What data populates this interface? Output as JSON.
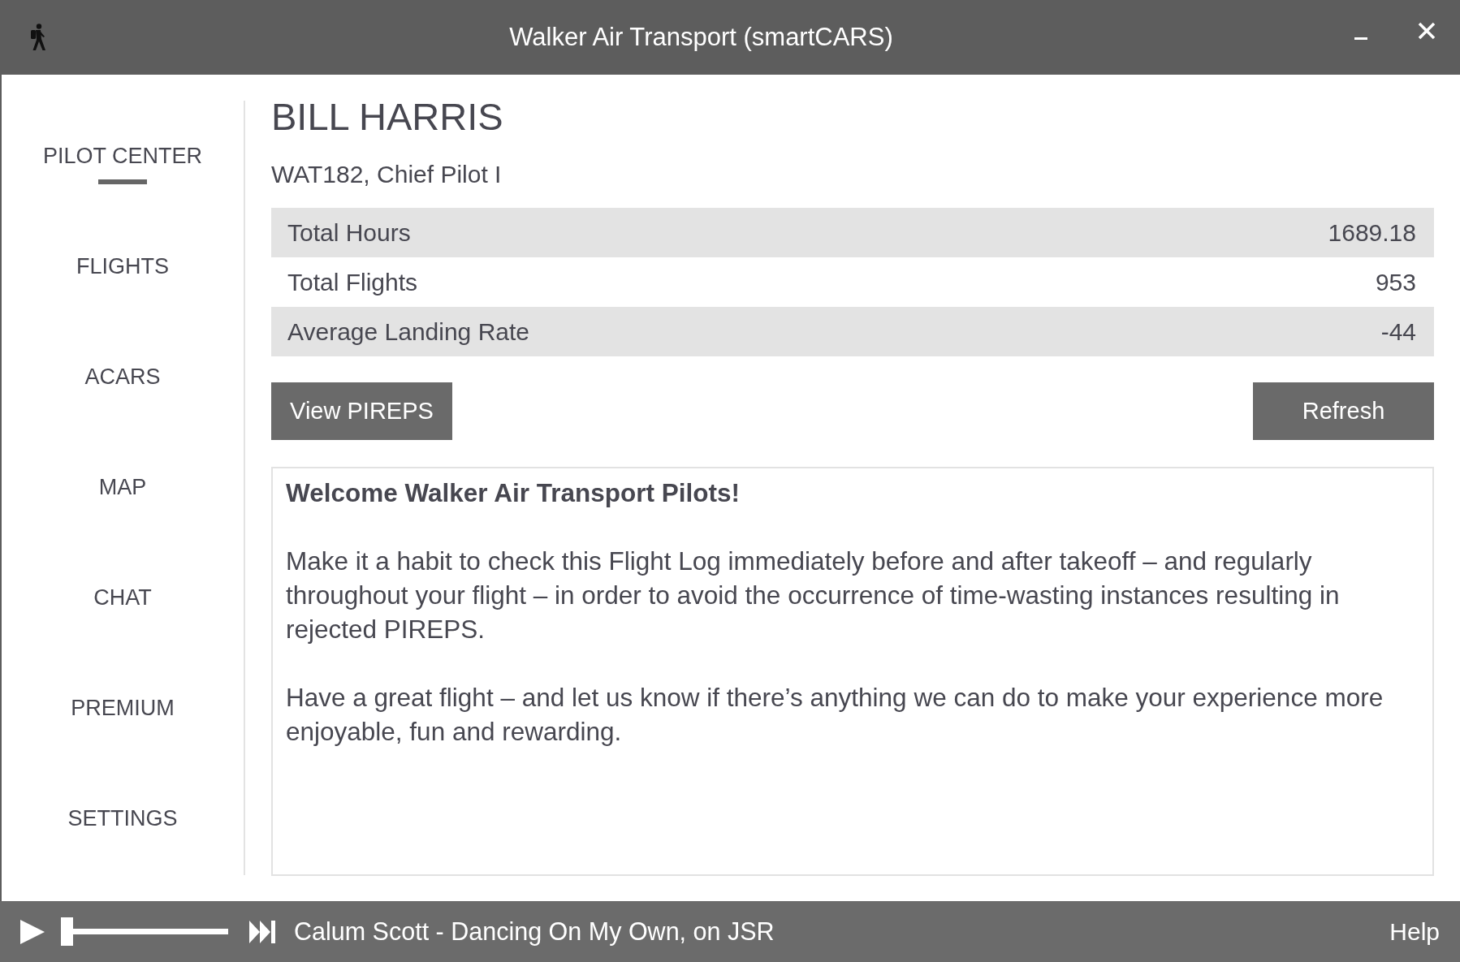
{
  "window": {
    "title": "Walker Air Transport (smartCARS)"
  },
  "sidebar": {
    "items": [
      {
        "label": "PILOT CENTER",
        "selected": true
      },
      {
        "label": "FLIGHTS",
        "selected": false
      },
      {
        "label": "ACARS",
        "selected": false
      },
      {
        "label": "MAP",
        "selected": false
      },
      {
        "label": "CHAT",
        "selected": false
      },
      {
        "label": "PREMIUM",
        "selected": false
      },
      {
        "label": "SETTINGS",
        "selected": false
      }
    ]
  },
  "profile": {
    "name": "BILL HARRIS",
    "subtitle": "WAT182, Chief Pilot I"
  },
  "stats": [
    {
      "label": "Total Hours",
      "value": "1689.18"
    },
    {
      "label": "Total Flights",
      "value": "953"
    },
    {
      "label": "Average Landing Rate",
      "value": "-44"
    }
  ],
  "actions": [
    {
      "label": "View PIREPS"
    },
    {
      "label": "Refresh"
    }
  ],
  "message": {
    "title": "Welcome Walker Air Transport Pilots!",
    "paragraphs": [
      "Make it a habit to check this Flight Log immediately before and after takeoff – and regularly throughout your flight – in order to avoid the occurrence of time-wasting instances resulting in rejected PIREPS.",
      "Have a great flight – and let us know if there’s anything we can do to make your experience more enjoyable, fun and rewarding."
    ]
  },
  "player": {
    "level": 0,
    "now_playing": "Calum Scott - Dancing On My Own, on JSR",
    "help": "Help"
  }
}
